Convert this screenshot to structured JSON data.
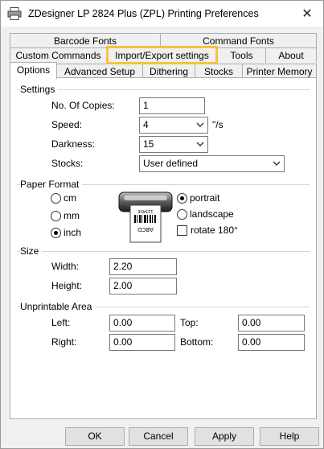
{
  "window": {
    "title": "ZDesigner LP 2824 Plus (ZPL) Printing Preferences",
    "close_glyph": "✕"
  },
  "tabs": {
    "row1": [
      {
        "label": "Barcode Fonts"
      },
      {
        "label": "Command Fonts"
      }
    ],
    "row2": [
      {
        "label": "Custom Commands"
      },
      {
        "label": "Import/Export settings"
      },
      {
        "label": "Tools"
      },
      {
        "label": "About"
      }
    ],
    "row3": [
      {
        "label": "Options"
      },
      {
        "label": "Advanced Setup"
      },
      {
        "label": "Dithering"
      },
      {
        "label": "Stocks"
      },
      {
        "label": "Printer Memory"
      }
    ],
    "active": "Options",
    "highlighted": "Import/Export settings",
    "highlight_color": "#f5c242"
  },
  "settings": {
    "group_label": "Settings",
    "copies_label": "No. Of Copies:",
    "copies_value": "1",
    "speed_label": "Speed:",
    "speed_value": "4",
    "speed_unit": "\"/s",
    "darkness_label": "Darkness:",
    "darkness_value": "15",
    "stocks_label": "Stocks:",
    "stocks_value": "User defined"
  },
  "paper_format": {
    "group_label": "Paper Format",
    "units": [
      {
        "label": "cm",
        "selected": false
      },
      {
        "label": "mm",
        "selected": false
      },
      {
        "label": "inch",
        "selected": true
      }
    ],
    "orientation": [
      {
        "label": "portrait",
        "selected": true
      },
      {
        "label": "landscape",
        "selected": false
      }
    ],
    "rotate_label": "rotate 180°",
    "rotate_checked": false,
    "label_preview_text": "ABCD",
    "label_preview_code": "123456"
  },
  "size": {
    "group_label": "Size",
    "width_label": "Width:",
    "width_value": "2.20",
    "height_label": "Height:",
    "height_value": "2.00"
  },
  "unprintable": {
    "group_label": "Unprintable Area",
    "left_label": "Left:",
    "left_value": "0.00",
    "top_label": "Top:",
    "top_value": "0.00",
    "right_label": "Right:",
    "right_value": "0.00",
    "bottom_label": "Bottom:",
    "bottom_value": "0.00"
  },
  "buttons": {
    "ok": "OK",
    "cancel": "Cancel",
    "apply": "Apply",
    "help": "Help"
  }
}
